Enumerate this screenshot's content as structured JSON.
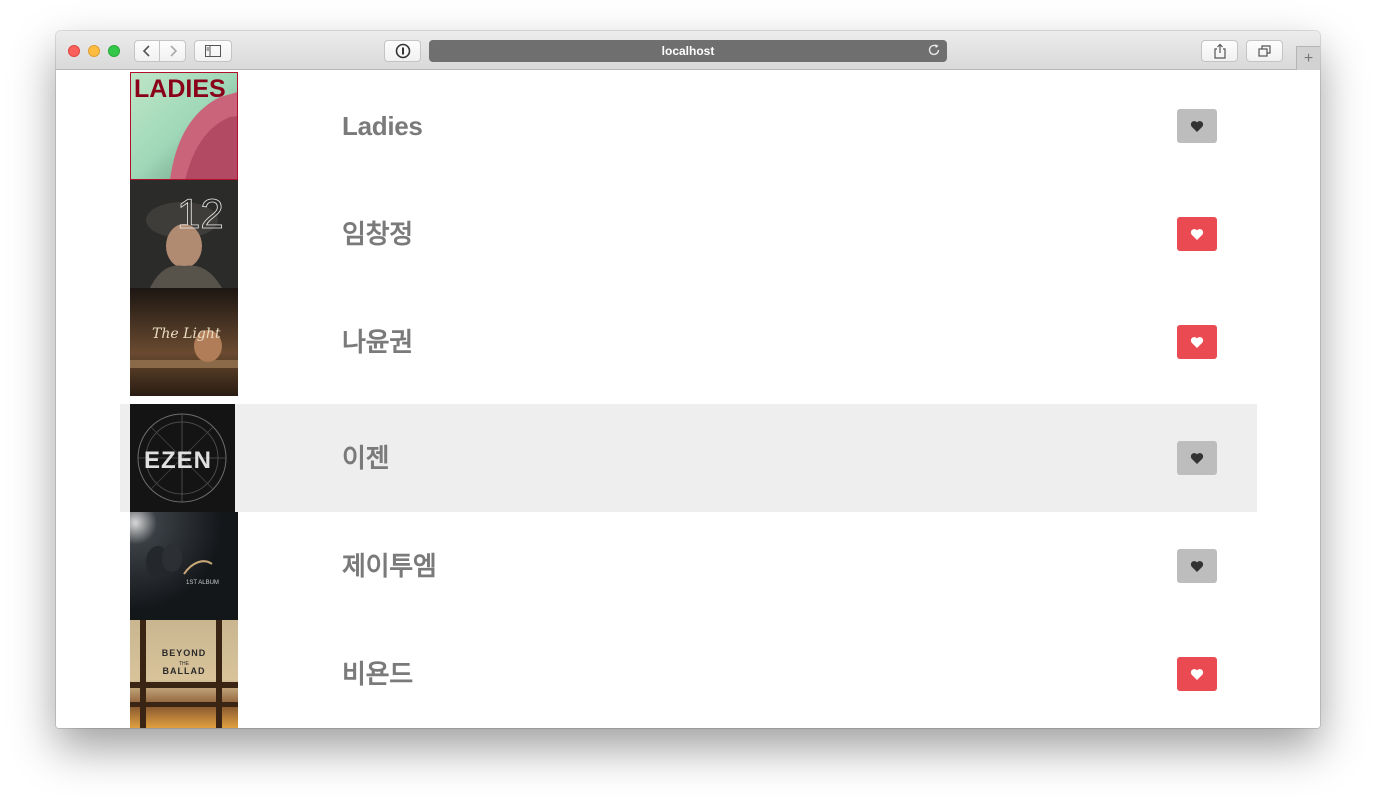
{
  "browser": {
    "url": "localhost",
    "buttons": {
      "back": "back",
      "forward": "forward",
      "sidebar": "sidebar",
      "reader": "reader",
      "share": "share",
      "tabs": "tabs",
      "new_tab": "+"
    }
  },
  "colors": {
    "heart_on": "#ea4a52",
    "heart_off": "#bdbdbd",
    "highlight_row": "#eeeeee",
    "artist_text": "#7a7a7a"
  },
  "artists": [
    {
      "name": "Ladies",
      "favorited": false,
      "cover_text": "LADIES",
      "cover_icon": "album-cover-ladies"
    },
    {
      "name": "임창정",
      "favorited": true,
      "cover_text": "12",
      "cover_icon": "album-cover-12"
    },
    {
      "name": "나윤권",
      "favorited": true,
      "cover_text": "The Light",
      "cover_icon": "album-cover-the-light"
    },
    {
      "name": "이젠",
      "favorited": false,
      "highlighted": true,
      "cover_text": "EZEN",
      "cover_icon": "album-cover-ezen"
    },
    {
      "name": "제이투엠",
      "favorited": false,
      "cover_text": "1ST ALBUM",
      "cover_icon": "album-cover-j2m"
    },
    {
      "name": "비욘드",
      "favorited": true,
      "cover_text_1": "BEYOND",
      "cover_text_2": "THE",
      "cover_text_3": "BALLAD",
      "cover_icon": "album-cover-beyond-the-ballad"
    }
  ]
}
